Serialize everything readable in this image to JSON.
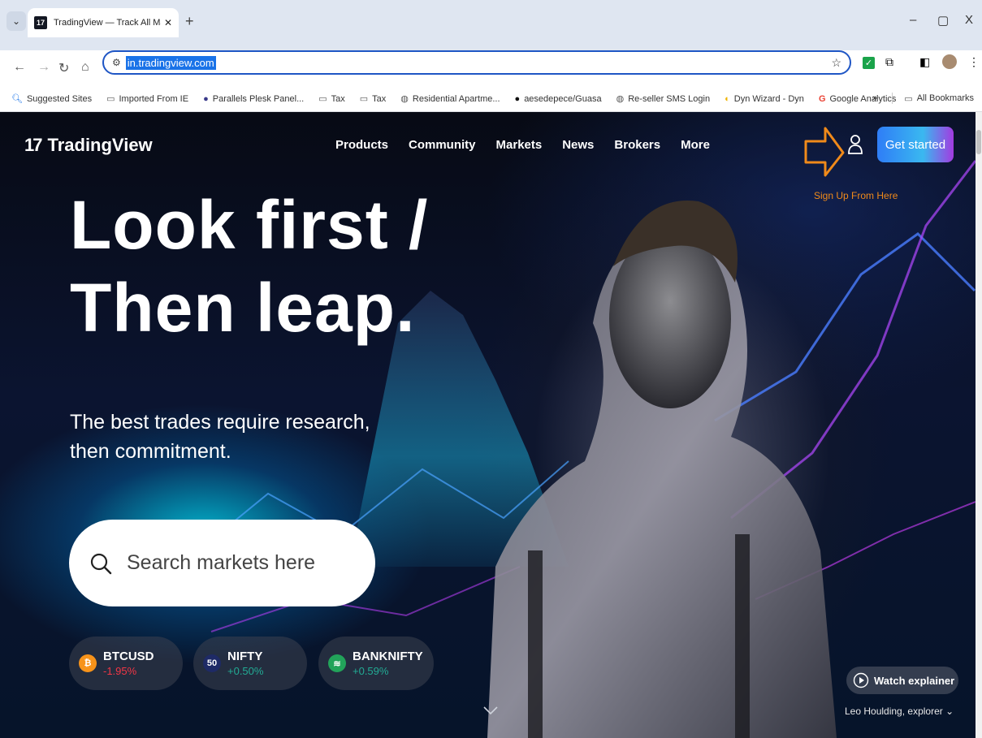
{
  "browser": {
    "tab_title": "TradingView — Track All Markets",
    "url": "in.tradingview.com",
    "bookmarks": [
      "Suggested Sites",
      "Imported From IE",
      "Parallels Plesk Panel...",
      "Tax",
      "Tax",
      "Residential Apartme...",
      "aesedepece/Guasa",
      "Re-seller SMS Login",
      "Dyn Wizard - Dyn",
      "Google Analytics"
    ],
    "overflow": "»",
    "all_bookmarks": "All Bookmarks"
  },
  "site": {
    "logo_mark": "17",
    "logo_text": "TradingView",
    "nav": [
      "Products",
      "Community",
      "Markets",
      "News",
      "Brokers",
      "More"
    ],
    "cta": "Get started",
    "annotation": "Sign Up From Here",
    "annotation_color": "#f08a1a"
  },
  "hero": {
    "line1": "Look first /",
    "line2": "Then leap.",
    "subtitle": "The best trades require research, then commitment.",
    "search_placeholder": "Search markets here"
  },
  "tickers": [
    {
      "symbol": "BTCUSD",
      "change": "-1.95%",
      "icon": "₿",
      "icon_color": "#f7931a",
      "change_color": "#f23645"
    },
    {
      "symbol": "NIFTY",
      "change": "+0.50%",
      "icon": "50",
      "icon_color": "#1e2a66",
      "change_color": "#22ab94"
    },
    {
      "symbol": "BANKNIFTY",
      "change": "+0.59%",
      "icon": "≋",
      "icon_color": "#22a35a",
      "change_color": "#22ab94"
    }
  ],
  "explainer": {
    "label": "Watch explainer",
    "caption": "Leo Houlding, explorer"
  }
}
